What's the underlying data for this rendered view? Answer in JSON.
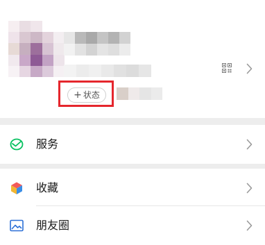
{
  "profile": {
    "status_button_label": "状态"
  },
  "menu": {
    "items": [
      {
        "label": "服务",
        "icon": "services-icon"
      },
      {
        "label": "收藏",
        "icon": "favorites-cube-icon"
      },
      {
        "label": "朋友圈",
        "icon": "moments-photo-icon"
      }
    ]
  },
  "colors": {
    "page_background": "#ededed",
    "card_background": "#ffffff",
    "services_green": "#07c160",
    "highlight_red": "#e5262d",
    "moments_blue": "#2b6fd6"
  }
}
